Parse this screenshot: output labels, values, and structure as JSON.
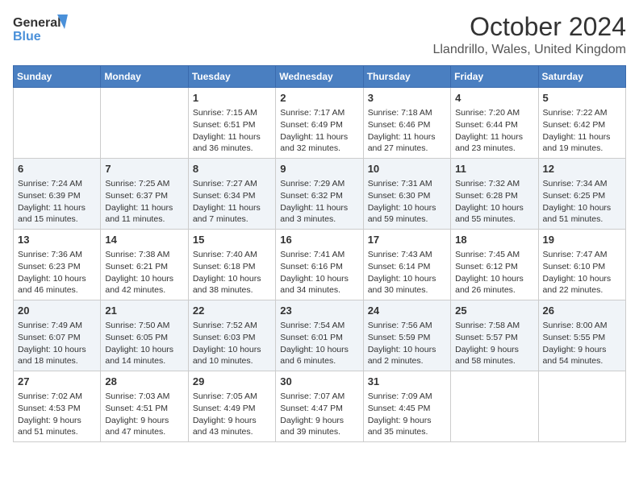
{
  "logo": {
    "text_general": "General",
    "text_blue": "Blue"
  },
  "title": "October 2024",
  "location": "Llandrillo, Wales, United Kingdom",
  "days_of_week": [
    "Sunday",
    "Monday",
    "Tuesday",
    "Wednesday",
    "Thursday",
    "Friday",
    "Saturday"
  ],
  "weeks": [
    [
      {
        "day": "",
        "info": ""
      },
      {
        "day": "",
        "info": ""
      },
      {
        "day": "1",
        "info": "Sunrise: 7:15 AM\nSunset: 6:51 PM\nDaylight: 11 hours and 36 minutes."
      },
      {
        "day": "2",
        "info": "Sunrise: 7:17 AM\nSunset: 6:49 PM\nDaylight: 11 hours and 32 minutes."
      },
      {
        "day": "3",
        "info": "Sunrise: 7:18 AM\nSunset: 6:46 PM\nDaylight: 11 hours and 27 minutes."
      },
      {
        "day": "4",
        "info": "Sunrise: 7:20 AM\nSunset: 6:44 PM\nDaylight: 11 hours and 23 minutes."
      },
      {
        "day": "5",
        "info": "Sunrise: 7:22 AM\nSunset: 6:42 PM\nDaylight: 11 hours and 19 minutes."
      }
    ],
    [
      {
        "day": "6",
        "info": "Sunrise: 7:24 AM\nSunset: 6:39 PM\nDaylight: 11 hours and 15 minutes."
      },
      {
        "day": "7",
        "info": "Sunrise: 7:25 AM\nSunset: 6:37 PM\nDaylight: 11 hours and 11 minutes."
      },
      {
        "day": "8",
        "info": "Sunrise: 7:27 AM\nSunset: 6:34 PM\nDaylight: 11 hours and 7 minutes."
      },
      {
        "day": "9",
        "info": "Sunrise: 7:29 AM\nSunset: 6:32 PM\nDaylight: 11 hours and 3 minutes."
      },
      {
        "day": "10",
        "info": "Sunrise: 7:31 AM\nSunset: 6:30 PM\nDaylight: 10 hours and 59 minutes."
      },
      {
        "day": "11",
        "info": "Sunrise: 7:32 AM\nSunset: 6:28 PM\nDaylight: 10 hours and 55 minutes."
      },
      {
        "day": "12",
        "info": "Sunrise: 7:34 AM\nSunset: 6:25 PM\nDaylight: 10 hours and 51 minutes."
      }
    ],
    [
      {
        "day": "13",
        "info": "Sunrise: 7:36 AM\nSunset: 6:23 PM\nDaylight: 10 hours and 46 minutes."
      },
      {
        "day": "14",
        "info": "Sunrise: 7:38 AM\nSunset: 6:21 PM\nDaylight: 10 hours and 42 minutes."
      },
      {
        "day": "15",
        "info": "Sunrise: 7:40 AM\nSunset: 6:18 PM\nDaylight: 10 hours and 38 minutes."
      },
      {
        "day": "16",
        "info": "Sunrise: 7:41 AM\nSunset: 6:16 PM\nDaylight: 10 hours and 34 minutes."
      },
      {
        "day": "17",
        "info": "Sunrise: 7:43 AM\nSunset: 6:14 PM\nDaylight: 10 hours and 30 minutes."
      },
      {
        "day": "18",
        "info": "Sunrise: 7:45 AM\nSunset: 6:12 PM\nDaylight: 10 hours and 26 minutes."
      },
      {
        "day": "19",
        "info": "Sunrise: 7:47 AM\nSunset: 6:10 PM\nDaylight: 10 hours and 22 minutes."
      }
    ],
    [
      {
        "day": "20",
        "info": "Sunrise: 7:49 AM\nSunset: 6:07 PM\nDaylight: 10 hours and 18 minutes."
      },
      {
        "day": "21",
        "info": "Sunrise: 7:50 AM\nSunset: 6:05 PM\nDaylight: 10 hours and 14 minutes."
      },
      {
        "day": "22",
        "info": "Sunrise: 7:52 AM\nSunset: 6:03 PM\nDaylight: 10 hours and 10 minutes."
      },
      {
        "day": "23",
        "info": "Sunrise: 7:54 AM\nSunset: 6:01 PM\nDaylight: 10 hours and 6 minutes."
      },
      {
        "day": "24",
        "info": "Sunrise: 7:56 AM\nSunset: 5:59 PM\nDaylight: 10 hours and 2 minutes."
      },
      {
        "day": "25",
        "info": "Sunrise: 7:58 AM\nSunset: 5:57 PM\nDaylight: 9 hours and 58 minutes."
      },
      {
        "day": "26",
        "info": "Sunrise: 8:00 AM\nSunset: 5:55 PM\nDaylight: 9 hours and 54 minutes."
      }
    ],
    [
      {
        "day": "27",
        "info": "Sunrise: 7:02 AM\nSunset: 4:53 PM\nDaylight: 9 hours and 51 minutes."
      },
      {
        "day": "28",
        "info": "Sunrise: 7:03 AM\nSunset: 4:51 PM\nDaylight: 9 hours and 47 minutes."
      },
      {
        "day": "29",
        "info": "Sunrise: 7:05 AM\nSunset: 4:49 PM\nDaylight: 9 hours and 43 minutes."
      },
      {
        "day": "30",
        "info": "Sunrise: 7:07 AM\nSunset: 4:47 PM\nDaylight: 9 hours and 39 minutes."
      },
      {
        "day": "31",
        "info": "Sunrise: 7:09 AM\nSunset: 4:45 PM\nDaylight: 9 hours and 35 minutes."
      },
      {
        "day": "",
        "info": ""
      },
      {
        "day": "",
        "info": ""
      }
    ]
  ]
}
